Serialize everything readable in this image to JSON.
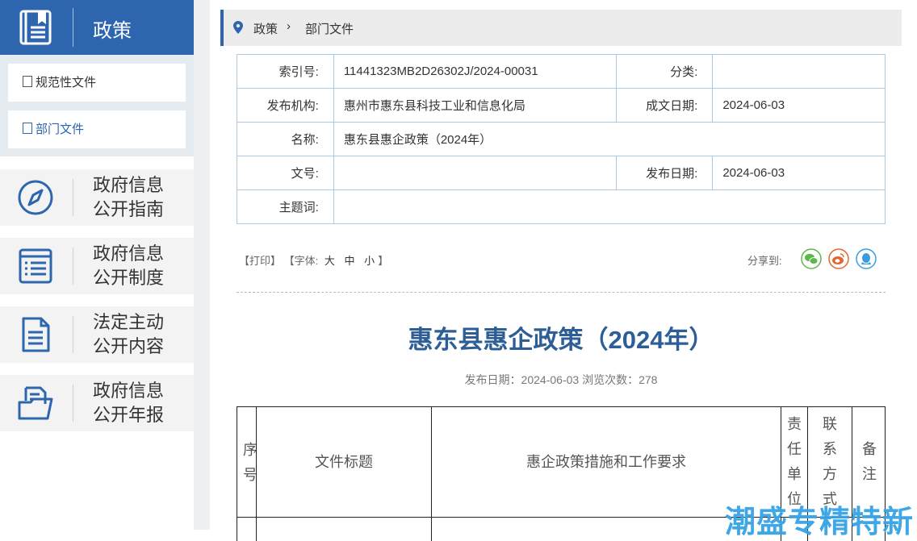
{
  "sidebar": {
    "header_title": "政策",
    "sub_items": [
      {
        "label": "规范性文件"
      },
      {
        "label": "部门文件"
      }
    ],
    "nav": [
      {
        "line1": "政府信息",
        "line2": "公开指南",
        "icon": "compass-icon"
      },
      {
        "line1": "政府信息",
        "line2": "公开制度",
        "icon": "list-icon"
      },
      {
        "line1": "法定主动",
        "line2": "公开内容",
        "icon": "document-icon"
      },
      {
        "line1": "政府信息",
        "line2": "公开年报",
        "icon": "folder-icon"
      }
    ]
  },
  "breadcrumb": {
    "level1": "政策",
    "separator": "›",
    "level2": "部门文件"
  },
  "meta": {
    "index_label": "索引号:",
    "index_value": "11441323MB2D26302J/2024-00031",
    "category_label": "分类:",
    "category_value": "",
    "publisher_label": "发布机构:",
    "publisher_value": "惠州市惠东县科技工业和信息化局",
    "created_label": "成文日期:",
    "created_value": "2024-06-03",
    "name_label": "名称:",
    "name_value": "惠东县惠企政策（2024年）",
    "docno_label": "文号:",
    "docno_value": "",
    "pubdate_label": "发布日期:",
    "pubdate_value": "2024-06-03",
    "keywords_label": "主题词:",
    "keywords_value": ""
  },
  "tools": {
    "print": "【打印】",
    "font_prefix": "【字体:",
    "size_large": "大",
    "size_medium": "中",
    "size_small": "小",
    "font_suffix": "】",
    "share_label": "分享到:"
  },
  "article": {
    "title": "惠东县惠企政策（2024年）",
    "publish_info": "发布日期：2024-06-03   浏览次数：278"
  },
  "table": {
    "col1": "序号",
    "col2": "文件标题",
    "col3": "惠企政策措施和工作要求",
    "col4": "责任单位",
    "col5": "联系方式",
    "col6": "备注"
  },
  "watermark": "潮盛专精特新",
  "colors": {
    "accent": "#2d66ae",
    "title": "#2d5f96",
    "border": "#a9cbe8",
    "wechat": "#5bb94b",
    "weibo": "#e5652e",
    "qq": "#3b9be0"
  }
}
